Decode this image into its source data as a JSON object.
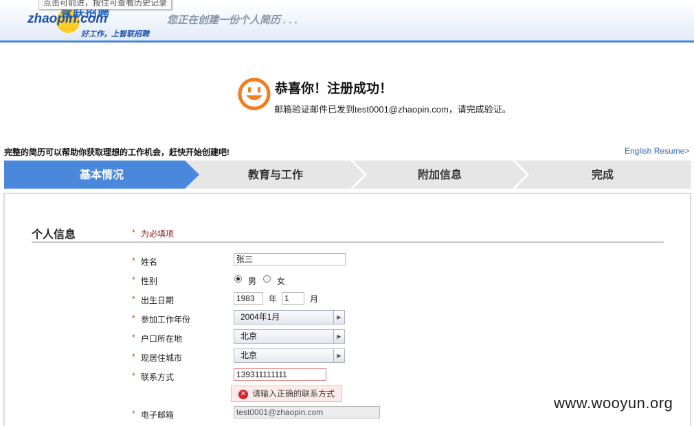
{
  "header": {
    "tooltip": "点击可前进，按住可查看历史记录",
    "logo_cn": "智联招聘",
    "logo_en": "zhaopin.com",
    "logo_slogan": "好工作，上智联招聘",
    "subtitle": "您正在创建一份个人简历 . . ."
  },
  "success": {
    "title": "恭喜你！注册成功！",
    "message": "邮箱验证邮件已发到test0001@zhaopin.com，请完成验证。",
    "icon": "smiley-icon"
  },
  "promo": {
    "text": "完整的简历可以帮助你获取理想的工作机会，赶快开始创建吧!",
    "english_link": "English Resume>"
  },
  "steps": [
    {
      "label": "基本情况",
      "active": true
    },
    {
      "label": "教育与工作",
      "active": false
    },
    {
      "label": "附加信息",
      "active": false
    },
    {
      "label": "完成",
      "active": false
    }
  ],
  "section": {
    "title": "个人信息",
    "required_note": "为必填项"
  },
  "form": {
    "name": {
      "label": "姓名",
      "value": "张三"
    },
    "gender": {
      "label": "性别",
      "options": [
        "男",
        "女"
      ],
      "selected": "男"
    },
    "birth": {
      "label": "出生日期",
      "year": "1983",
      "year_unit": "年",
      "month": "1",
      "month_unit": "月"
    },
    "work_start": {
      "label": "参加工作年份",
      "value": "2004年1月"
    },
    "hukou": {
      "label": "户口所在地",
      "value": "北京"
    },
    "residence": {
      "label": "现居住城市",
      "value": "北京"
    },
    "contact": {
      "label": "联系方式",
      "value": "139311111111",
      "error": "请输入正确的联系方式"
    },
    "email": {
      "label": "电子邮箱",
      "value": "test0001@zhaopin.com"
    }
  },
  "watermark": "www.wooyun.org",
  "colors": {
    "accent": "#4a88dc",
    "error": "#d5262b",
    "required_star": "#d03b1c",
    "smiley": "#f07d1e"
  }
}
